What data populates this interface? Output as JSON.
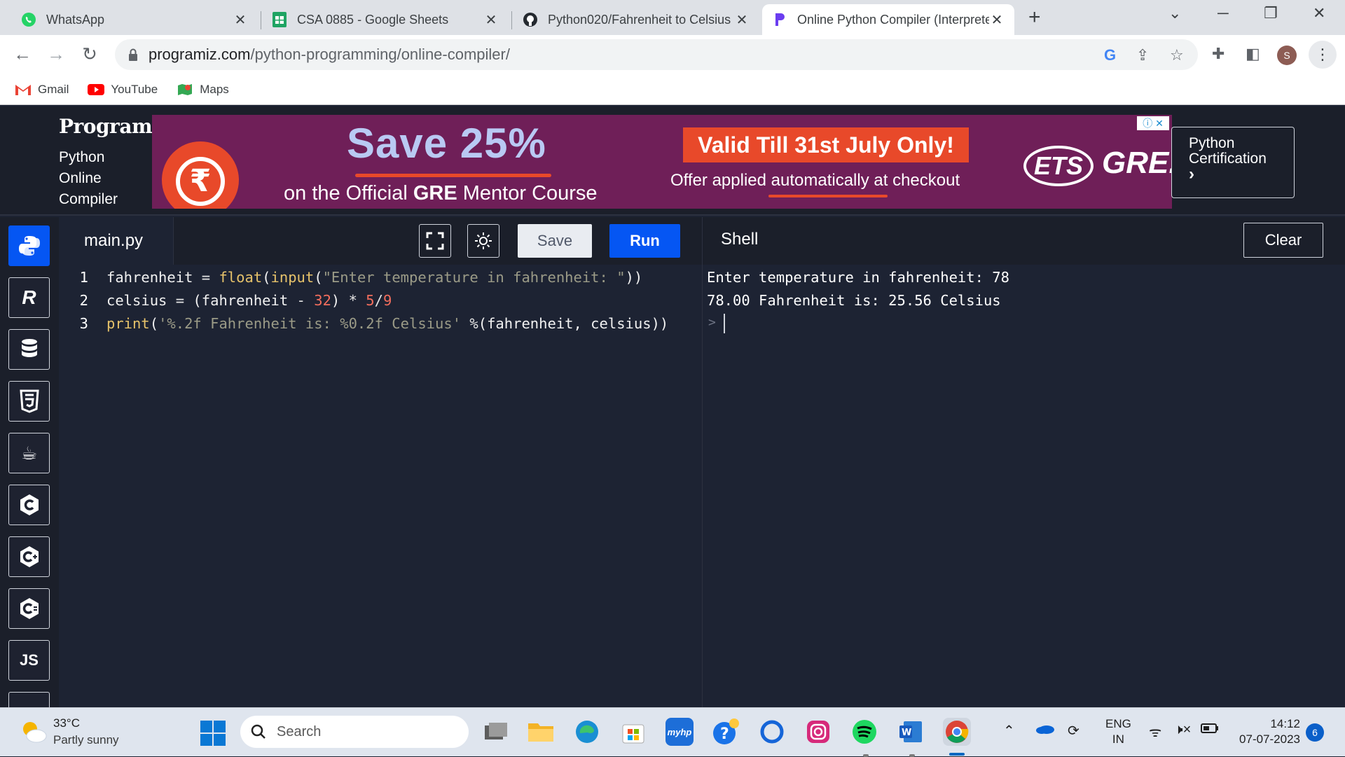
{
  "browser": {
    "tabs": [
      {
        "title": "WhatsApp",
        "icon": "whatsapp-icon"
      },
      {
        "title": "CSA 0885 - Google Sheets",
        "icon": "google-sheets-icon"
      },
      {
        "title": "Python020/Fahrenheit to Celsius",
        "icon": "github-icon"
      },
      {
        "title": "Online Python Compiler (Interpreter)",
        "icon": "programiz-icon",
        "active": true
      }
    ],
    "url_host": "programiz.com",
    "url_path": "/python-programming/online-compiler/",
    "profile_initial": "S",
    "bookmarks": [
      {
        "label": "Gmail",
        "icon": "gmail-icon"
      },
      {
        "label": "YouTube",
        "icon": "youtube-icon"
      },
      {
        "label": "Maps",
        "icon": "maps-icon"
      }
    ]
  },
  "site": {
    "logo": "Programiz",
    "subtitle_lines": [
      "Python",
      "Online",
      "Compiler"
    ],
    "ad": {
      "headline": "Save 25%",
      "subline_pre": "on the Official ",
      "subline_bold": "GRE",
      "subline_post": " Mentor Course",
      "valid": "Valid Till 31st July Only!",
      "offer": "Offer applied automatically at checkout",
      "brand_ets": "ETS",
      "brand_gre": "GRE."
    },
    "cert_line1": "Python",
    "cert_line2": "Certification",
    "cert_arrow": "›"
  },
  "ide": {
    "filename": "main.py",
    "save_label": "Save",
    "run_label": "Run",
    "shell_label": "Shell",
    "clear_label": "Clear",
    "sidebar_languages": [
      "Python",
      "R",
      "SQL",
      "HTML",
      "Java",
      "C",
      "C++",
      "C#",
      "JS"
    ],
    "code_lines": [
      "fahrenheit = float(input(\"Enter temperature in fahrenheit: \"))",
      "celsius = (fahrenheit - 32) * 5/9",
      "print('%.2f Fahrenheit is: %0.2f Celsius' %(fahrenheit, celsius))"
    ],
    "line_numbers": [
      "1",
      "2",
      "3"
    ],
    "shell_output": [
      "Enter temperature in fahrenheit: 78",
      "78.00 Fahrenheit is: 25.56 Celsius"
    ],
    "shell_prompt": ">"
  },
  "taskbar": {
    "temp": "33°C",
    "weather": "Partly sunny",
    "search_placeholder": "Search",
    "lang_1": "ENG",
    "lang_2": "IN",
    "time": "14:12",
    "date": "07-07-2023",
    "notifications": "6"
  },
  "colors": {
    "accent": "#0556f3",
    "editor_bg": "#1d2333",
    "ad_bg": "#6f1f58"
  }
}
